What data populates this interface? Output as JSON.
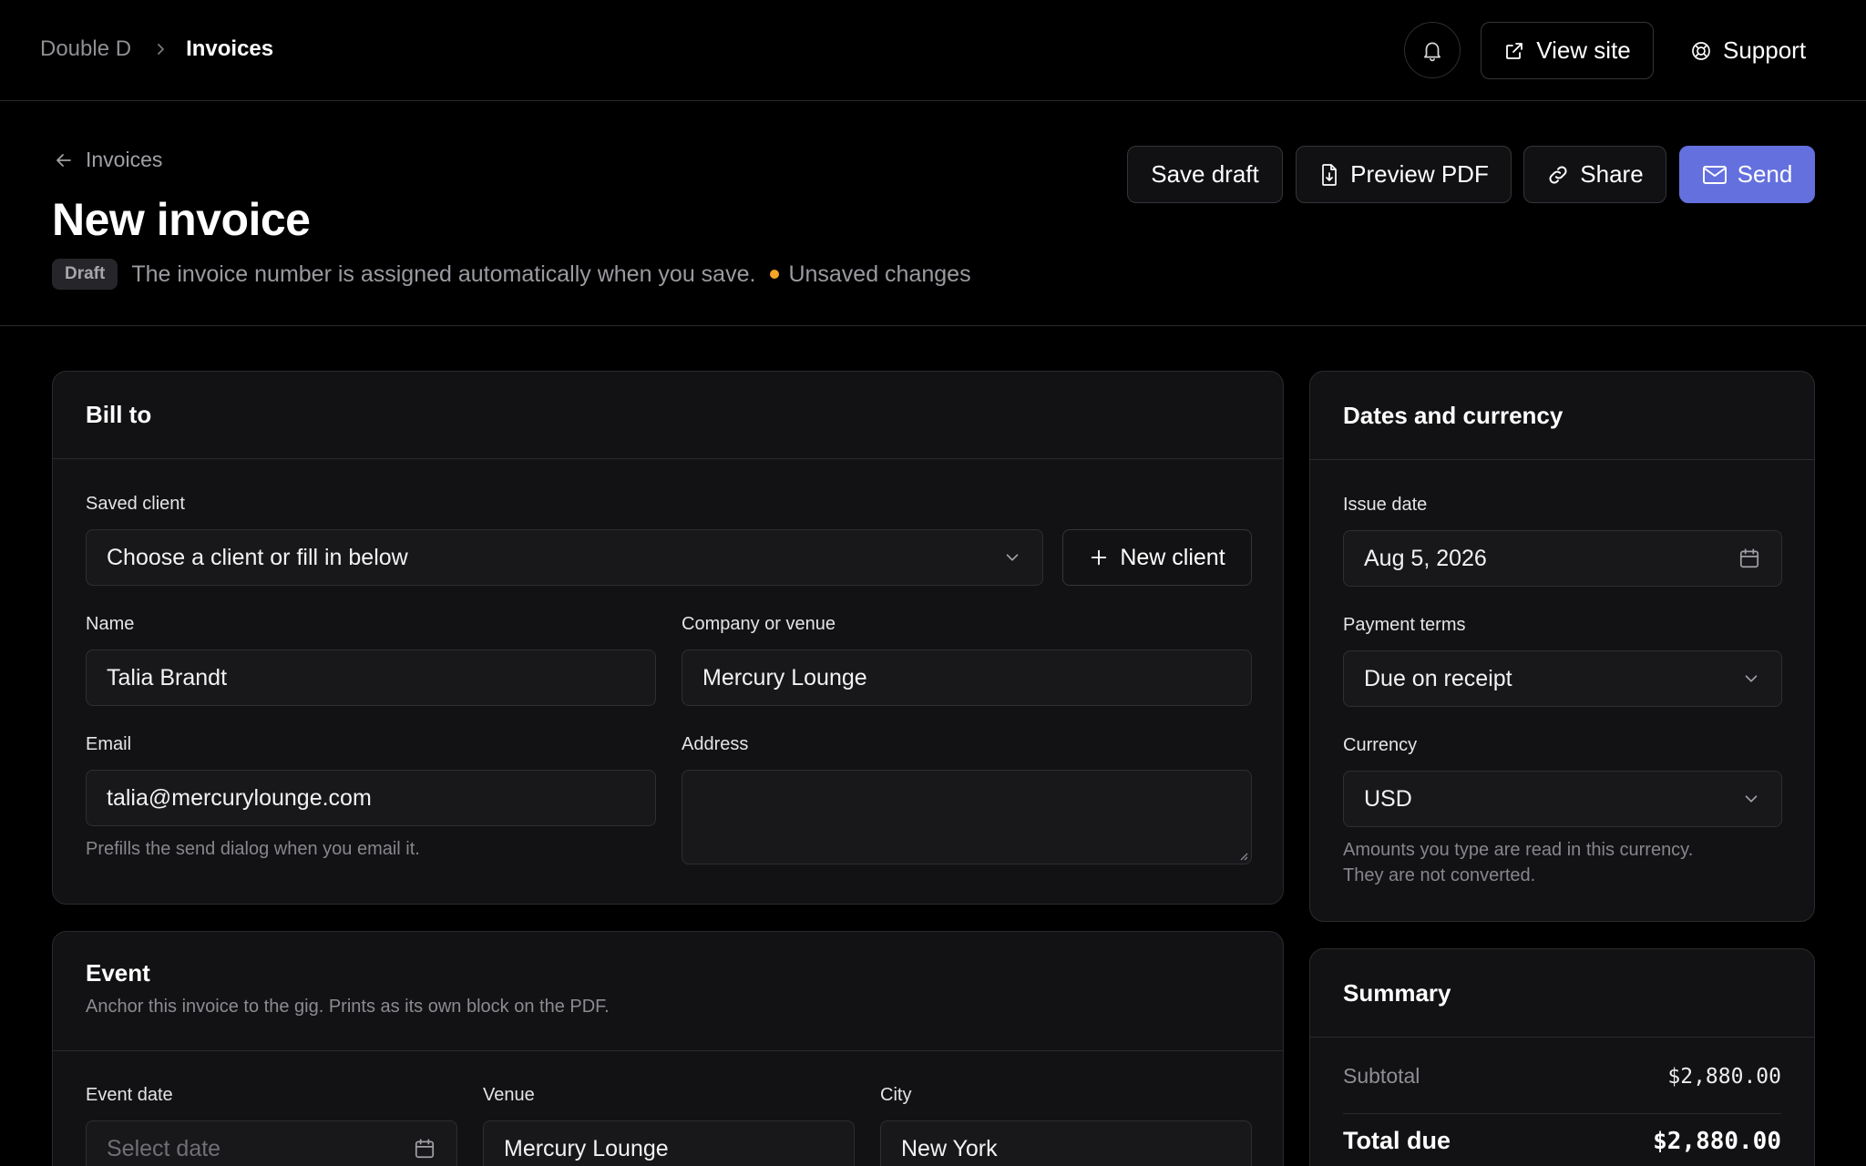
{
  "breadcrumb": {
    "root": "Double D",
    "current": "Invoices"
  },
  "topbar": {
    "view_site": "View site",
    "support": "Support"
  },
  "header": {
    "back_label": "Invoices",
    "title": "New invoice",
    "badge": "Draft",
    "note": "The invoice number is assigned automatically when you save.",
    "unsaved": "Unsaved changes"
  },
  "actions": {
    "save_draft": "Save draft",
    "preview_pdf": "Preview PDF",
    "share": "Share",
    "send": "Send"
  },
  "bill_to": {
    "title": "Bill to",
    "saved_client_label": "Saved client",
    "saved_client_value": "Choose a client or fill in below",
    "new_client": "New client",
    "name_label": "Name",
    "name_value": "Talia Brandt",
    "company_label": "Company or venue",
    "company_value": "Mercury Lounge",
    "email_label": "Email",
    "email_value": "talia@mercurylounge.com",
    "email_hint": "Prefills the send dialog when you email it.",
    "address_label": "Address",
    "address_value": ""
  },
  "event": {
    "title": "Event",
    "subtitle": "Anchor this invoice to the gig. Prints as its own block on the PDF.",
    "date_label": "Event date",
    "date_placeholder": "Select date",
    "venue_label": "Venue",
    "venue_value": "Mercury Lounge",
    "city_label": "City",
    "city_value": "New York"
  },
  "dates": {
    "title": "Dates and currency",
    "issue_label": "Issue date",
    "issue_value": "Aug 5, 2026",
    "terms_label": "Payment terms",
    "terms_value": "Due on receipt",
    "currency_label": "Currency",
    "currency_value": "USD",
    "currency_hint_1": "Amounts you type are read in this currency.",
    "currency_hint_2": "They are not converted."
  },
  "summary": {
    "title": "Summary",
    "subtotal_label": "Subtotal",
    "subtotal_value": "$2,880.00",
    "total_label": "Total due",
    "total_value": "$2,880.00"
  },
  "colors": {
    "accent": "#6470de",
    "unsaved_dot": "#f5a524",
    "background": "#000000",
    "card": "#121214"
  },
  "icons": [
    "chevron-right-icon",
    "bell-icon",
    "external-link-icon",
    "lifebuoy-icon",
    "arrow-left-icon",
    "file-download-icon",
    "link-icon",
    "mail-icon",
    "chevron-down-icon",
    "plus-icon",
    "calendar-icon"
  ]
}
